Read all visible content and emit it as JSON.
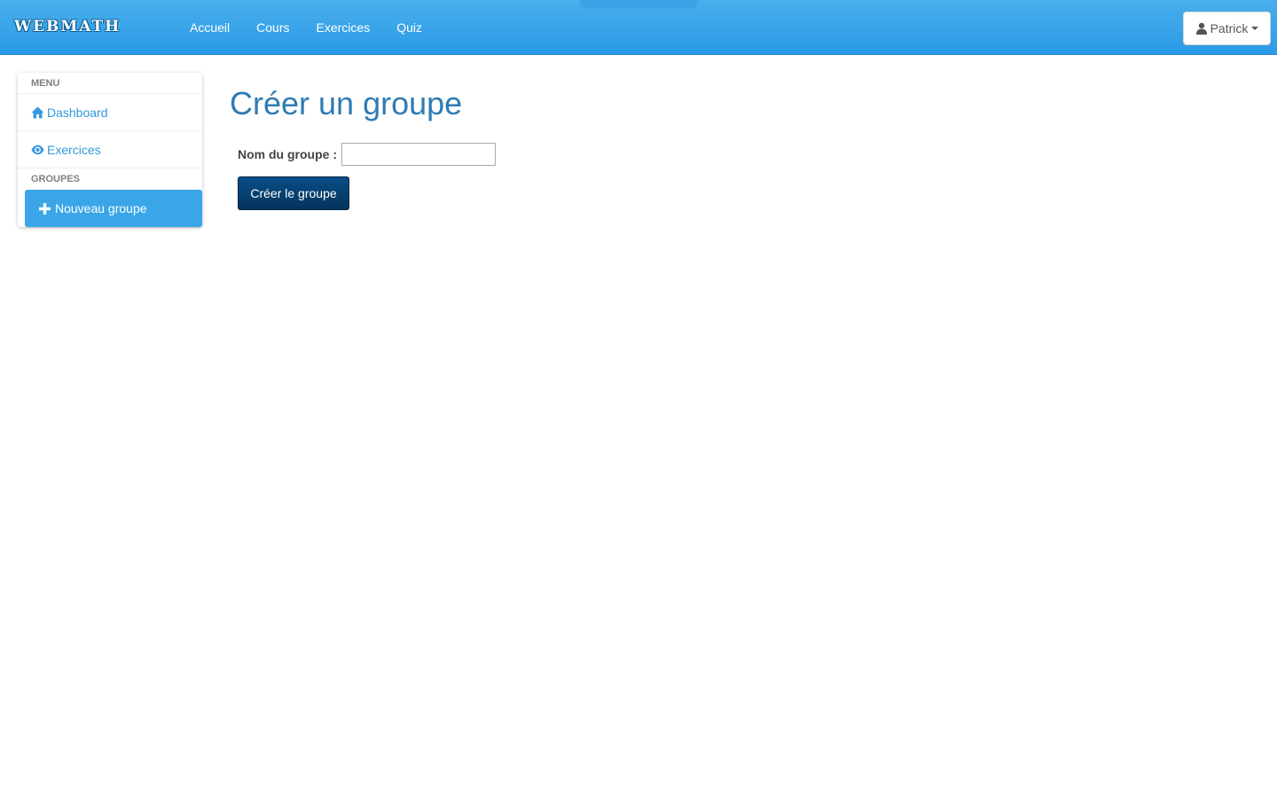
{
  "navbar": {
    "brand": "WEBMATH",
    "links": [
      {
        "label": "Accueil"
      },
      {
        "label": "Cours"
      },
      {
        "label": "Exercices"
      },
      {
        "label": "Quiz"
      }
    ],
    "user": {
      "name": "Patrick",
      "icon": "user-icon"
    }
  },
  "sidebar": {
    "menu_header": "MENU",
    "items": [
      {
        "label": "Dashboard",
        "icon": "home-icon"
      },
      {
        "label": "Exercices",
        "icon": "eye-icon"
      }
    ],
    "groups_header": "GROUPES",
    "active_item": {
      "label": "Nouveau groupe",
      "icon": "plus-icon"
    }
  },
  "main": {
    "title": "Créer un groupe",
    "form": {
      "label": "Nom du groupe :",
      "value": "",
      "submit_label": "Créer le groupe"
    }
  },
  "colors": {
    "navbar": "#2a9ae6",
    "link": "#3399dd",
    "title": "#2e7bb4",
    "active_item": "#3aa6e8",
    "submit_button": "#084e86"
  }
}
